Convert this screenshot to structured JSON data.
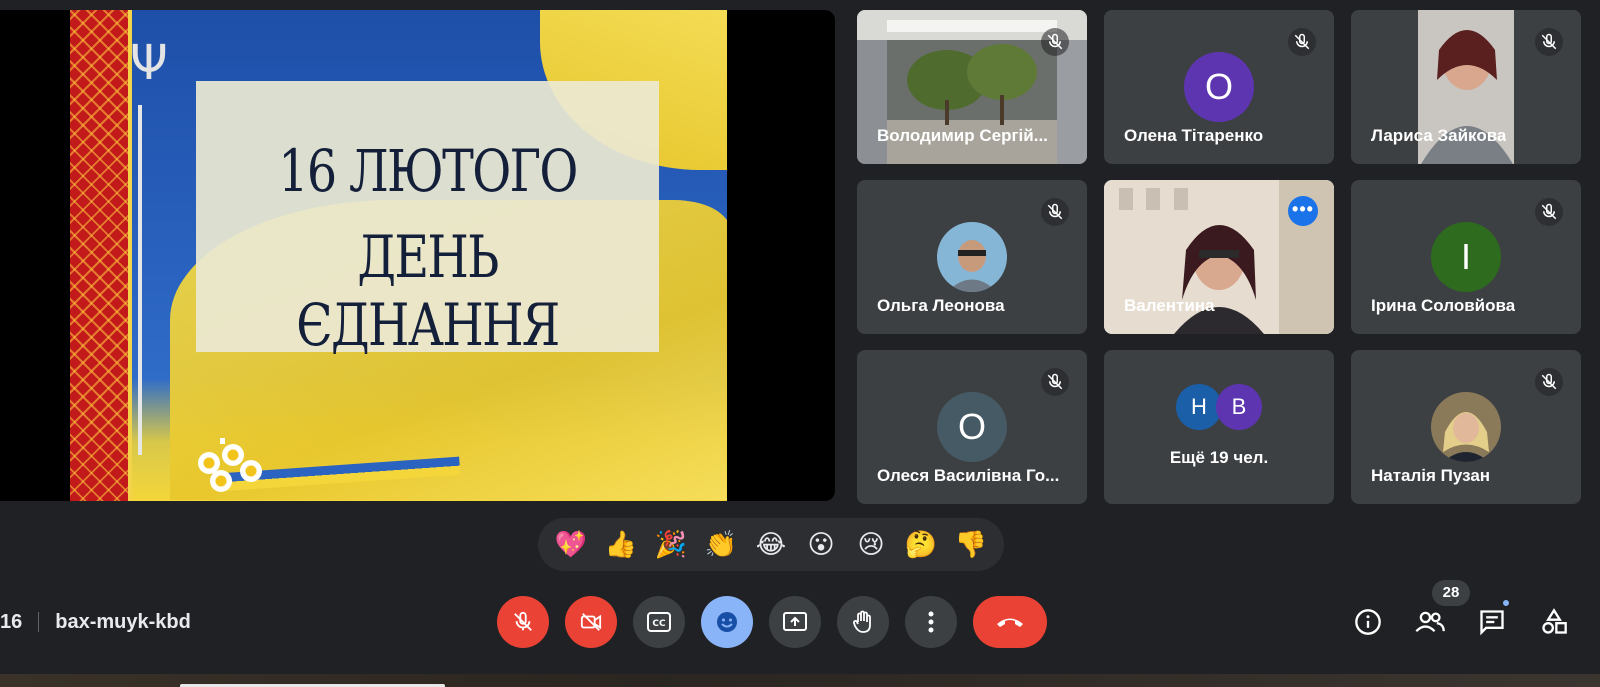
{
  "slide": {
    "line1": "16 ЛЮТОГО",
    "line2": "ДЕНЬ ЄДНАННЯ"
  },
  "participants": [
    {
      "name": "Володимир Сергій...",
      "muted": true,
      "type": "photo-scene"
    },
    {
      "name": "Олена Тітаренко",
      "muted": true,
      "initial": "О",
      "color": "#5e35b1"
    },
    {
      "name": "Лариса Зайкова",
      "muted": true,
      "type": "photo-person"
    },
    {
      "name": "Ольга Леонова",
      "muted": true,
      "type": "photo-avatar"
    },
    {
      "name": "Валентина",
      "muted": false,
      "active": true,
      "type": "video"
    },
    {
      "name": "Ірина Соловйова",
      "muted": true,
      "initial": "І",
      "color": "#2e6b1e"
    },
    {
      "name": "Олеся Василівна Го...",
      "muted": true,
      "initial": "О",
      "color": "#455a64"
    },
    {
      "name": "Ещё 19 чел.",
      "initials": [
        "Н",
        "В"
      ],
      "colors": [
        "#1a5fa8",
        "#5e35b1"
      ]
    },
    {
      "name": "Наталія Пузан",
      "muted": true,
      "type": "photo-avatar"
    }
  ],
  "reactions": [
    "💖",
    "👍",
    "🎉",
    "👏",
    "😂",
    "😮",
    "😢",
    "🤔",
    "👎"
  ],
  "meeting": {
    "time": "16",
    "code": "bax-muyk-kbd"
  },
  "controls": [
    "mic-off",
    "camera-off",
    "captions",
    "emoji",
    "present",
    "raise-hand",
    "more-options",
    "leave-call"
  ],
  "right_panel": {
    "people_count": "28",
    "icons": [
      "info-icon",
      "people-icon",
      "chat-icon",
      "activities-icon"
    ]
  },
  "colors": {
    "background": "#202124",
    "tile": "#3c4043",
    "accent": "#8ab4f8",
    "danger": "#ea4335"
  }
}
